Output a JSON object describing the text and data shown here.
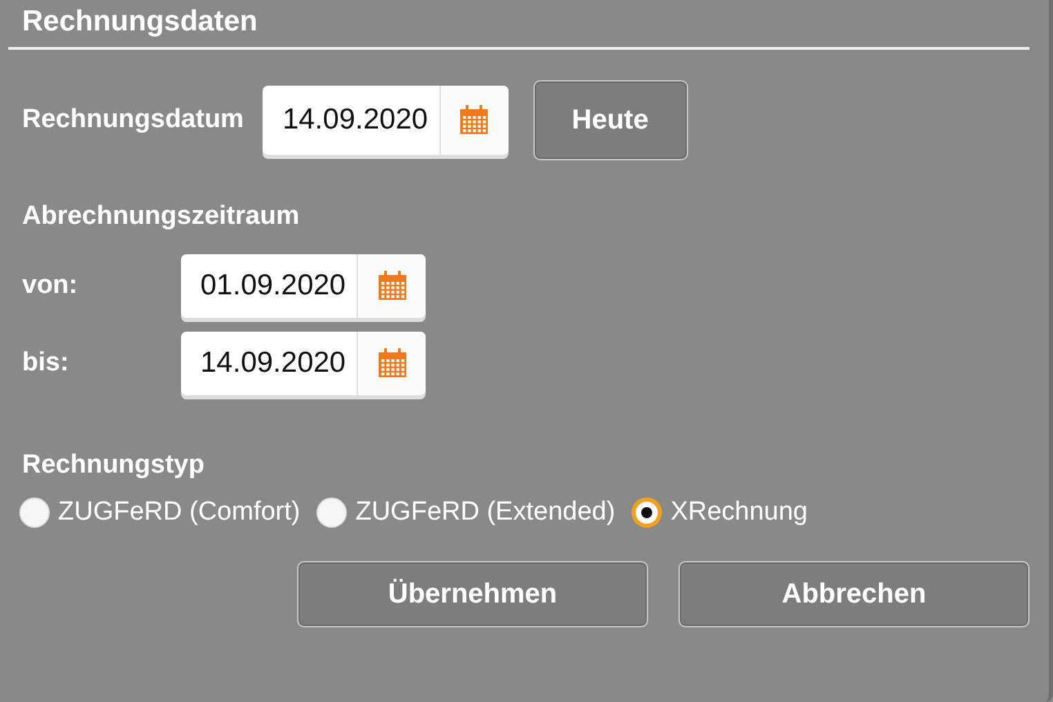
{
  "title": "Rechnungsdaten",
  "invoice_date": {
    "label": "Rechnungsdatum",
    "value": "14.09.2020",
    "today_button": "Heute"
  },
  "period": {
    "heading": "Abrechnungszeitraum",
    "fields": [
      {
        "label": "von:",
        "value": "01.09.2020"
      },
      {
        "label": "bis:",
        "value": "14.09.2020"
      }
    ]
  },
  "invoice_type": {
    "heading": "Rechnungstyp",
    "options": [
      {
        "label": "ZUGFeRD (Comfort)",
        "selected": false
      },
      {
        "label": "ZUGFeRD (Extended)",
        "selected": false
      },
      {
        "label": "XRechnung",
        "selected": true
      }
    ]
  },
  "buttons": [
    "Übernehmen",
    "Abbrechen"
  ]
}
